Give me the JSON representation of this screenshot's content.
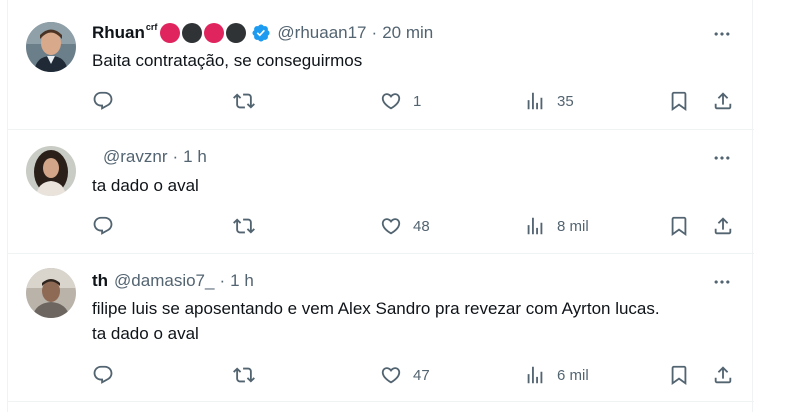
{
  "tweets": [
    {
      "name": "Rhuan",
      "name_suffix": "crf",
      "badge_colors": [
        "#e0245e",
        "#2f3336",
        "#e0245e",
        "#2f3336"
      ],
      "verified": true,
      "handle": "@rhuaan17",
      "separator": "·",
      "time": "20 min",
      "text": "Baita contratação, se conseguirmos",
      "likes": "1",
      "views": "35"
    },
    {
      "name": "",
      "handle": "@ravznr",
      "separator": "·",
      "time": "1 h",
      "text": "ta dado o aval",
      "likes": "48",
      "views": "8 mil"
    },
    {
      "name": "th",
      "handle": "@damasio7_",
      "separator": "·",
      "time": "1 h",
      "text_lines": [
        "filipe luis se aposentando e vem Alex Sandro pra revezar com Ayrton lucas.",
        "ta dado o aval"
      ],
      "likes": "47",
      "views": "6 mil"
    }
  ],
  "icons": {
    "reply": "speech-bubble-icon",
    "retweet": "retweet-arrows-icon",
    "like": "heart-icon",
    "views": "bar-chart-icon",
    "bookmark": "bookmark-icon",
    "share": "upload-arrow-icon",
    "more": "three-dots-icon",
    "verified": "blue-check-badge-icon"
  },
  "colors": {
    "secondary_text": "#536471",
    "primary_text": "#0f1419",
    "verified_blue": "#1d9bf0",
    "divider": "#eff3f4"
  }
}
